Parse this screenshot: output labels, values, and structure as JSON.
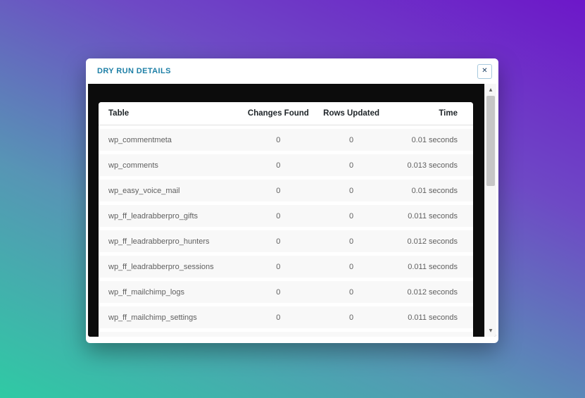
{
  "colors": {
    "accent": "#1d7fa6",
    "gradient_top": "#6d17c9",
    "gradient_bottom": "#2fcaa4",
    "body_background": "#0c0c0c",
    "row_stripe": "#f8f8f8"
  },
  "modal": {
    "title": "DRY RUN DETAILS",
    "close_label": "✕"
  },
  "scrollbar": {
    "up_arrow": "▲",
    "down_arrow": "▼"
  },
  "table": {
    "headers": [
      "Table",
      "Changes Found",
      "Rows Updated",
      "Time"
    ],
    "rows": [
      {
        "name": "wp_commentmeta",
        "changes": "0",
        "rows_updated": "0",
        "time": "0.01 seconds"
      },
      {
        "name": "wp_comments",
        "changes": "0",
        "rows_updated": "0",
        "time": "0.013 seconds"
      },
      {
        "name": "wp_easy_voice_mail",
        "changes": "0",
        "rows_updated": "0",
        "time": "0.01 seconds"
      },
      {
        "name": "wp_ff_leadrabberpro_gifts",
        "changes": "0",
        "rows_updated": "0",
        "time": "0.011 seconds"
      },
      {
        "name": "wp_ff_leadrabberpro_hunters",
        "changes": "0",
        "rows_updated": "0",
        "time": "0.012 seconds"
      },
      {
        "name": "wp_ff_leadrabberpro_sessions",
        "changes": "0",
        "rows_updated": "0",
        "time": "0.011 seconds"
      },
      {
        "name": "wp_ff_mailchimp_logs",
        "changes": "0",
        "rows_updated": "0",
        "time": "0.012 seconds"
      },
      {
        "name": "wp_ff_mailchimp_settings",
        "changes": "0",
        "rows_updated": "0",
        "time": "0.011 seconds"
      }
    ]
  }
}
